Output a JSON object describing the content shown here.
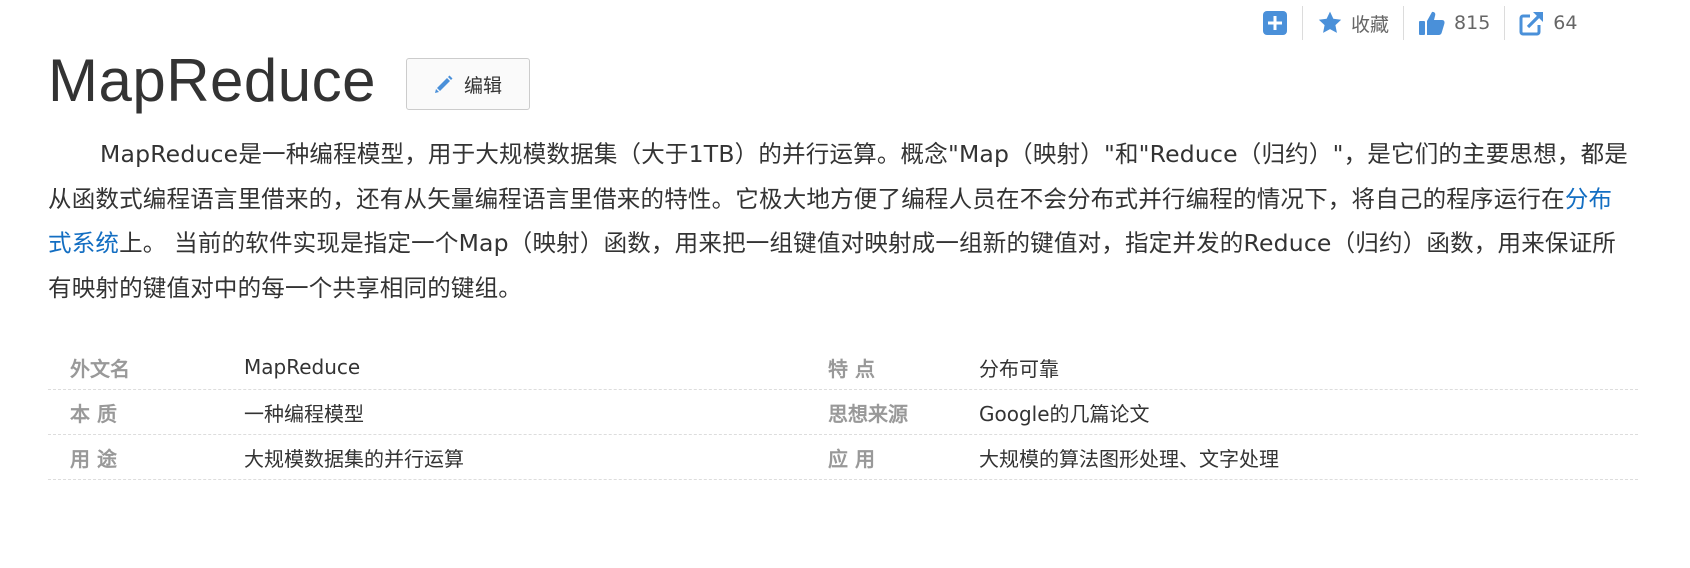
{
  "toolbar": {
    "add_icon": "plus-square-icon",
    "favorite_label": "收藏",
    "like_count": "815",
    "share_count": "64"
  },
  "header": {
    "title": "MapReduce",
    "edit_label": "编辑"
  },
  "summary": {
    "part1": "MapReduce是一种编程模型，用于大规模数据集（大于1TB）的并行运算。概念\"Map（映射）\"和\"Reduce（归约）\"，是它们的主要思想，都是从函数式编程语言里借来的，还有从矢量编程语言里借来的特性。它极大地方便了编程人员在不会分布式并行编程的情况下，将自己的程序运行在",
    "link": "分布式系统",
    "part2": "上。 当前的软件实现是指定一个Map（映射）函数，用来把一组键值对映射成一组新的键值对，指定并发的Reduce（归约）函数，用来保证所有映射的键值对中的每一个共享相同的键组。"
  },
  "info_rows": [
    {
      "k1": "外文名",
      "v1": "MapReduce",
      "k2": "特    点",
      "v2": "分布可靠"
    },
    {
      "k1": "本    质",
      "v1": "一种编程模型",
      "k2": "思想来源",
      "v2": "Google的几篇论文"
    },
    {
      "k1": "用    途",
      "v1": "大规模数据集的并行运算",
      "k2": "应    用",
      "v2": "大规模的算法图形处理、文字处理"
    }
  ],
  "colors": {
    "accent_blue": "#4a90d9",
    "link_blue": "#136ec2",
    "text": "#333333",
    "muted": "#999999"
  }
}
